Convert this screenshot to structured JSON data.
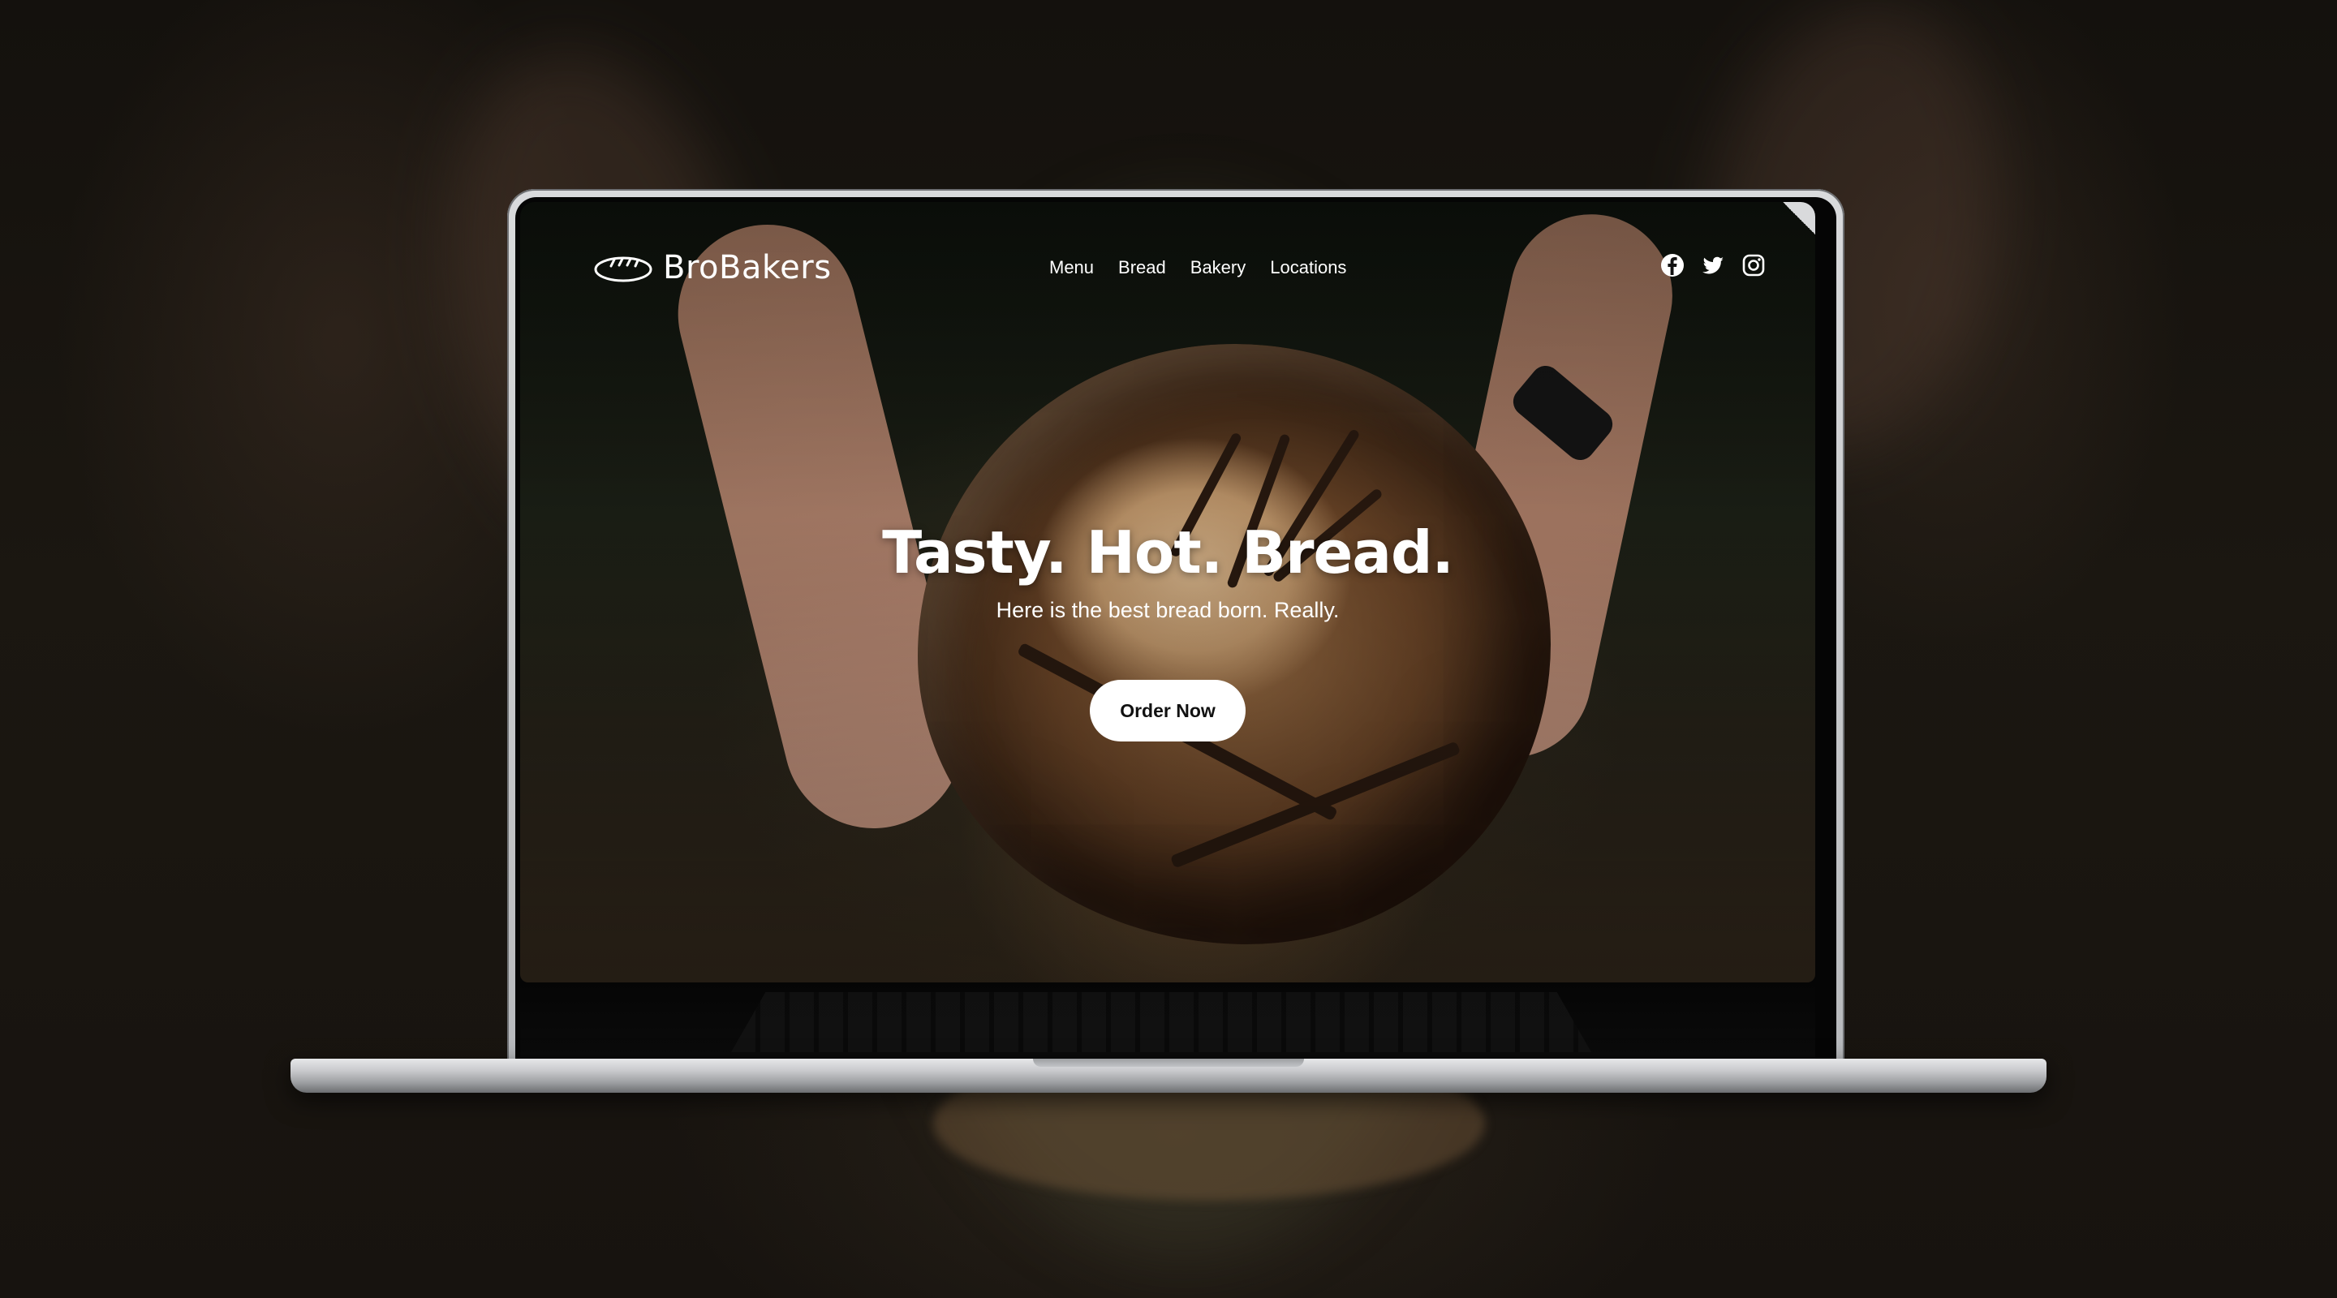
{
  "site": {
    "brand": "BroBakers",
    "nav": [
      {
        "label": "Menu"
      },
      {
        "label": "Bread"
      },
      {
        "label": "Bakery"
      },
      {
        "label": "Locations"
      }
    ],
    "social": [
      {
        "icon": "facebook-icon"
      },
      {
        "icon": "twitter-icon"
      },
      {
        "icon": "instagram-icon"
      }
    ]
  },
  "hero": {
    "title": "Tasty. Hot. Bread.",
    "subtitle": "Here is the best bread born. Really.",
    "cta_label": "Order Now"
  },
  "colors": {
    "text": "#ffffff",
    "button_bg": "#ffffff",
    "button_text": "#111111",
    "laptop_frame": "#c9cacd",
    "background": "#0b0a08"
  }
}
